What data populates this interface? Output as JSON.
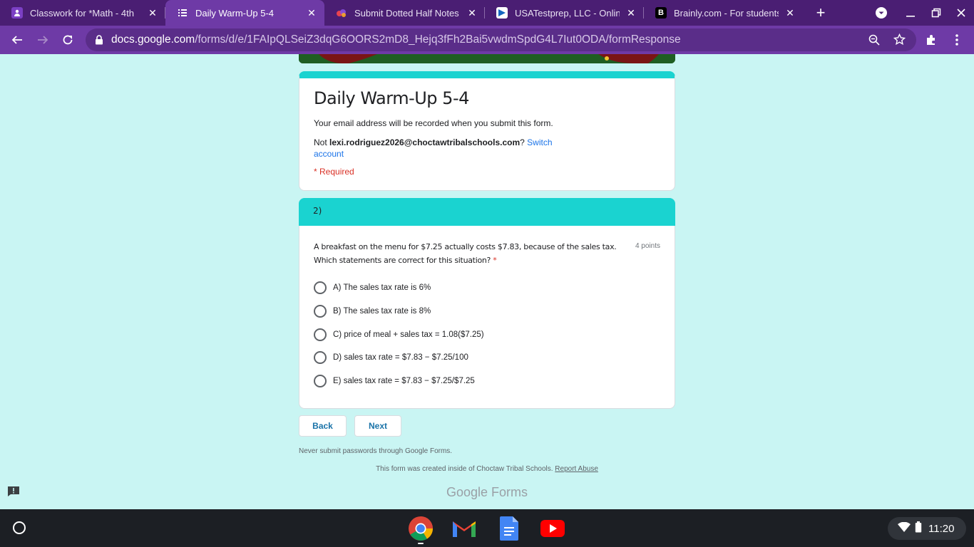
{
  "browser": {
    "tabs": [
      {
        "title": "Classwork for *Math - 4th",
        "icon": "classroom-icon",
        "active": false
      },
      {
        "title": "Daily Warm-Up 5-4",
        "icon": "forms-icon",
        "active": true
      },
      {
        "title": "Submit Dotted Half Notes",
        "icon": "app-icon",
        "active": false
      },
      {
        "title": "USATestprep, LLC - Online",
        "icon": "usatestprep-icon",
        "active": false
      },
      {
        "title": "Brainly.com - For students",
        "icon": "brainly-icon",
        "active": false
      }
    ],
    "url_host": "docs.google.com",
    "url_path": "/forms/d/e/1FAIpQLSeiZ3dqG6OORS2mD8_Hejq3fFh2Bai5vwdmSpdG4L7Iut0ODA/formResponse"
  },
  "form": {
    "title": "Daily Warm-Up 5-4",
    "email_note": "Your email address will be recorded when you submit this form.",
    "not_prefix": "Not ",
    "account_email": "lexi.rodriguez2026@choctawtribalschools.com",
    "switch_q": "?",
    "switch_label": "Switch account",
    "required_note": "* Required",
    "section_title": "2)",
    "question": {
      "text": "A breakfast on the menu for $7.25 actually costs $7.83, because of the sales tax. Which statements are correct for this situation?",
      "required_mark": "*",
      "points": "4 points",
      "options": [
        "A) The sales tax rate is 6%",
        "B) The sales tax rate is 8%",
        "C) price of meal + sales tax = 1.08($7.25)",
        "D) sales tax rate = $7.83 − $7.25/100",
        "E) sales tax rate = $7.83 − $7.25/$7.25"
      ]
    },
    "back_label": "Back",
    "next_label": "Next",
    "password_note": "Never submit passwords through Google Forms.",
    "created_note": "This form was created inside of Choctaw Tribal Schools.",
    "report_abuse": "Report Abuse",
    "brand": "Google Forms"
  },
  "shelf": {
    "apps": [
      "chrome-icon",
      "gmail-icon",
      "docs-icon",
      "youtube-icon"
    ],
    "time": "11:20"
  }
}
